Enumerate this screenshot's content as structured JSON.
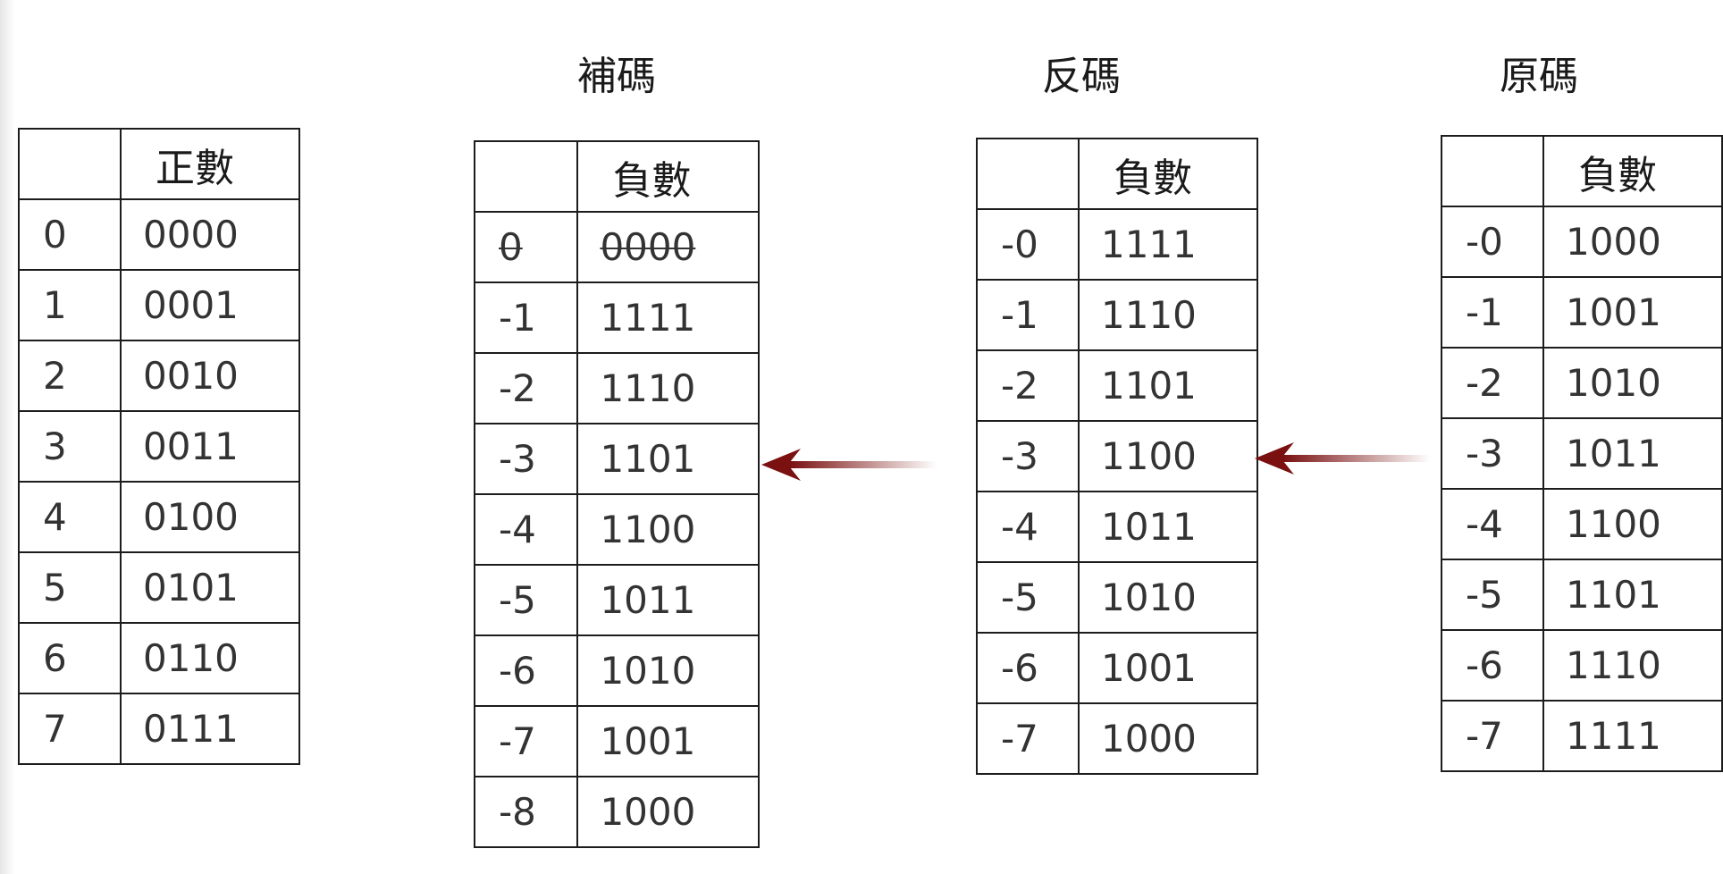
{
  "titles": {
    "complement": "補碼",
    "ones_complement": "反碼",
    "sign_magnitude": "原碼"
  },
  "tables": {
    "positive": {
      "header": [
        "",
        "正數"
      ],
      "rows": [
        [
          "0",
          "0000"
        ],
        [
          "1",
          "0001"
        ],
        [
          "2",
          "0010"
        ],
        [
          "3",
          "0011"
        ],
        [
          "4",
          "0100"
        ],
        [
          "5",
          "0101"
        ],
        [
          "6",
          "0110"
        ],
        [
          "7",
          "0111"
        ]
      ]
    },
    "complement": {
      "header": [
        "",
        "負數"
      ],
      "rows": [
        [
          "0",
          "0000"
        ],
        [
          "-1",
          "1111"
        ],
        [
          "-2",
          "1110"
        ],
        [
          "-3",
          "1101"
        ],
        [
          "-4",
          "1100"
        ],
        [
          "-5",
          "1011"
        ],
        [
          "-6",
          "1010"
        ],
        [
          "-7",
          "1001"
        ],
        [
          "-8",
          "1000"
        ]
      ],
      "struck_row": 0
    },
    "ones_complement": {
      "header": [
        "",
        "負數"
      ],
      "rows": [
        [
          "-0",
          "1111"
        ],
        [
          "-1",
          "1110"
        ],
        [
          "-2",
          "1101"
        ],
        [
          "-3",
          "1100"
        ],
        [
          "-4",
          "1011"
        ],
        [
          "-5",
          "1010"
        ],
        [
          "-6",
          "1001"
        ],
        [
          "-7",
          "1000"
        ]
      ]
    },
    "sign_magnitude": {
      "header": [
        "",
        "負數"
      ],
      "rows": [
        [
          "-0",
          "1000"
        ],
        [
          "-1",
          "1001"
        ],
        [
          "-2",
          "1010"
        ],
        [
          "-3",
          "1011"
        ],
        [
          "-4",
          "1100"
        ],
        [
          "-5",
          "1101"
        ],
        [
          "-6",
          "1110"
        ],
        [
          "-7",
          "1111"
        ]
      ]
    }
  },
  "arrow_color": "#7a1010"
}
